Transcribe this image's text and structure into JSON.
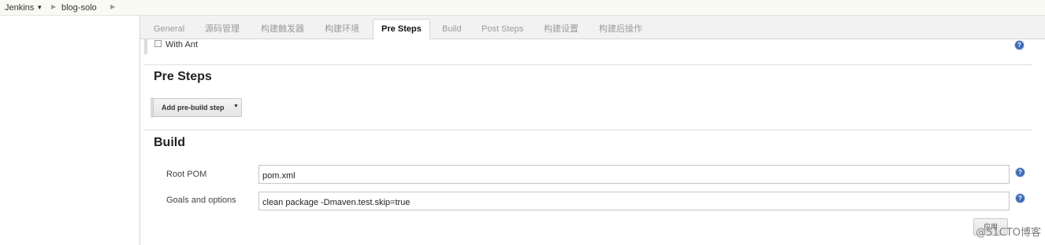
{
  "breadcrumb": {
    "jenkins": "Jenkins",
    "job": "blog-solo"
  },
  "tabs": [
    {
      "label": "General"
    },
    {
      "label": "源码管理"
    },
    {
      "label": "构建触发器"
    },
    {
      "label": "构建环境"
    },
    {
      "label": "Pre Steps",
      "active": true
    },
    {
      "label": "Build"
    },
    {
      "label": "Post Steps"
    },
    {
      "label": "构建设置"
    },
    {
      "label": "构建后操作"
    }
  ],
  "build_env": {
    "with_ant_label": "With Ant",
    "with_ant_checked": false
  },
  "pre_steps": {
    "title": "Pre Steps",
    "add_button": "Add pre-build step"
  },
  "build": {
    "title": "Build",
    "root_pom_label": "Root POM",
    "root_pom_value": "pom.xml",
    "goals_label": "Goals and options",
    "goals_value": "clean package -Dmaven.test.skip=true"
  },
  "apply_button": "应用",
  "watermark": "@51CTO博客",
  "colors": {
    "help_icon": "#3f6cb8",
    "breadcrumb_bg": "#f9faf2",
    "tabbar_bg": "#f2f2f2"
  }
}
